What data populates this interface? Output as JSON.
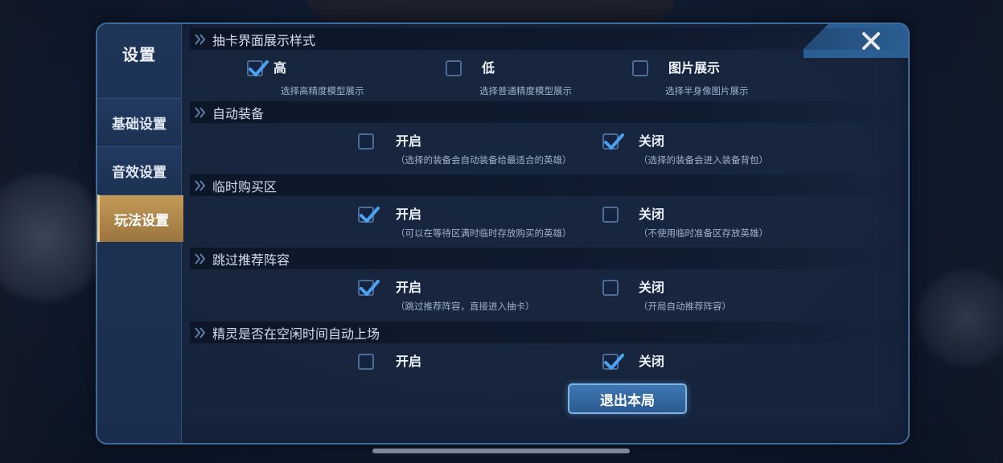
{
  "sidebar": {
    "title": "设置",
    "tabs": [
      {
        "label": "基础设置"
      },
      {
        "label": "音效设置"
      },
      {
        "label": "玩法设置"
      }
    ]
  },
  "sections": [
    {
      "title": "抽卡界面展示样式",
      "options": [
        {
          "label": "高",
          "desc": "选择高精度模型展示",
          "checked": true
        },
        {
          "label": "低",
          "desc": "选择普通精度模型展示",
          "checked": false
        },
        {
          "label": "图片展示",
          "desc": "选择半身像图片展示",
          "checked": false
        }
      ]
    },
    {
      "title": "自动装备",
      "options": [
        {
          "label": "开启",
          "desc": "（选择的装备会自动装备给最适合的英雄）",
          "checked": false
        },
        {
          "label": "关闭",
          "desc": "（选择的装备会进入装备背包）",
          "checked": true
        }
      ]
    },
    {
      "title": "临时购买区",
      "options": [
        {
          "label": "开启",
          "desc": "（可以在等待区满时临时存放购买的英雄）",
          "checked": true
        },
        {
          "label": "关闭",
          "desc": "（不使用临时准备区存放英雄）",
          "checked": false
        }
      ]
    },
    {
      "title": "跳过推荐阵容",
      "options": [
        {
          "label": "开启",
          "desc": "（跳过推荐阵容，直接进入抽卡）",
          "checked": true
        },
        {
          "label": "关闭",
          "desc": "（开局自动推荐阵容）",
          "checked": false
        }
      ]
    },
    {
      "title": "精灵是否在空闲时间自动上场",
      "options": [
        {
          "label": "开启",
          "checked": false
        },
        {
          "label": "关闭",
          "checked": true
        }
      ]
    }
  ],
  "exit_button": "退出本局",
  "colors": {
    "accent_blue": "#2b5e93",
    "active_tab_gold": "#c39a57",
    "check_blue": "#4aa3f0"
  }
}
